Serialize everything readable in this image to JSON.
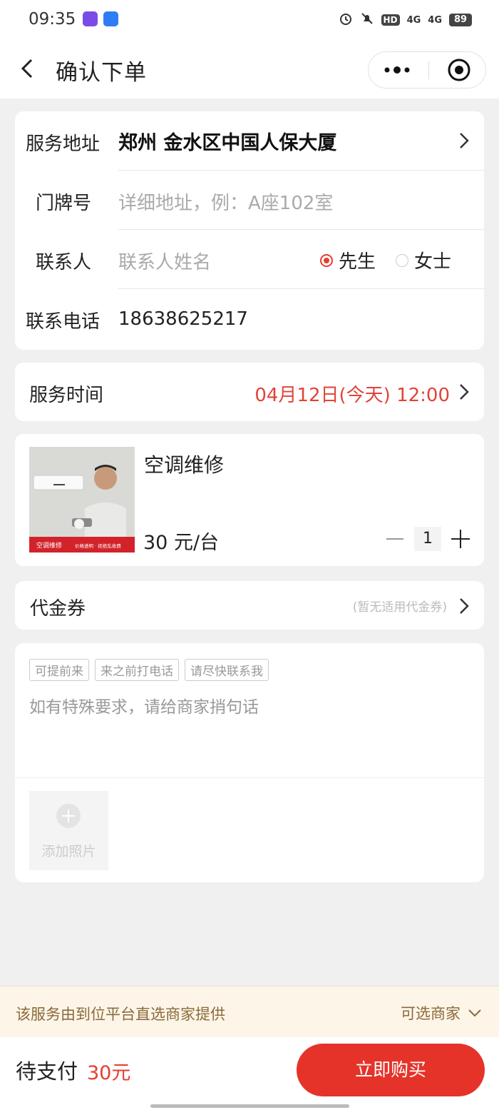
{
  "status_bar": {
    "time": "09:35",
    "net1": "4G",
    "net2": "4G",
    "hd_label": "HD",
    "battery": "89"
  },
  "nav": {
    "title": "确认下单",
    "icons": {
      "back": "chevron-left-icon",
      "more": "more-dots-icon",
      "close": "target-close-icon"
    }
  },
  "address": {
    "service_address_label": "服务地址",
    "service_address_value": "郑州 金水区中国人保大厦",
    "door_number_label": "门牌号",
    "door_number_placeholder": "详细地址，例：A座102室",
    "contact_label": "联系人",
    "contact_placeholder": "联系人姓名",
    "gender_options": [
      "先生",
      "女士"
    ],
    "gender_selected": "先生",
    "phone_label": "联系电话",
    "phone_value": "18638625217"
  },
  "service_time": {
    "label": "服务时间",
    "value": "04月12日(今天) 12:00"
  },
  "product": {
    "name": "空调维修",
    "price": "30 元/台",
    "quantity": "1",
    "image_banner_left": "空调维修",
    "image_banner_right": "价格透明 · 拒绝乱收费"
  },
  "coupon": {
    "label": "代金券",
    "hint": "(暂无适用代金券)"
  },
  "note": {
    "quick_tags": [
      "可提前来",
      "来之前打电话",
      "请尽快联系我"
    ],
    "placeholder": "如有特殊要求，请给商家捎句话",
    "add_photo_label": "添加照片"
  },
  "merchant_bar": {
    "text": "该服务由到位平台直选商家提供",
    "select_label": "可选商家"
  },
  "bottom_bar": {
    "pay_label": "待支付",
    "amount": "30元",
    "buy_button": "立即购买"
  },
  "colors": {
    "accent_red": "#e5332a",
    "time_red": "#e0443a",
    "merchant_bg": "#fdf5e8",
    "merchant_text": "#8a6a3a"
  }
}
